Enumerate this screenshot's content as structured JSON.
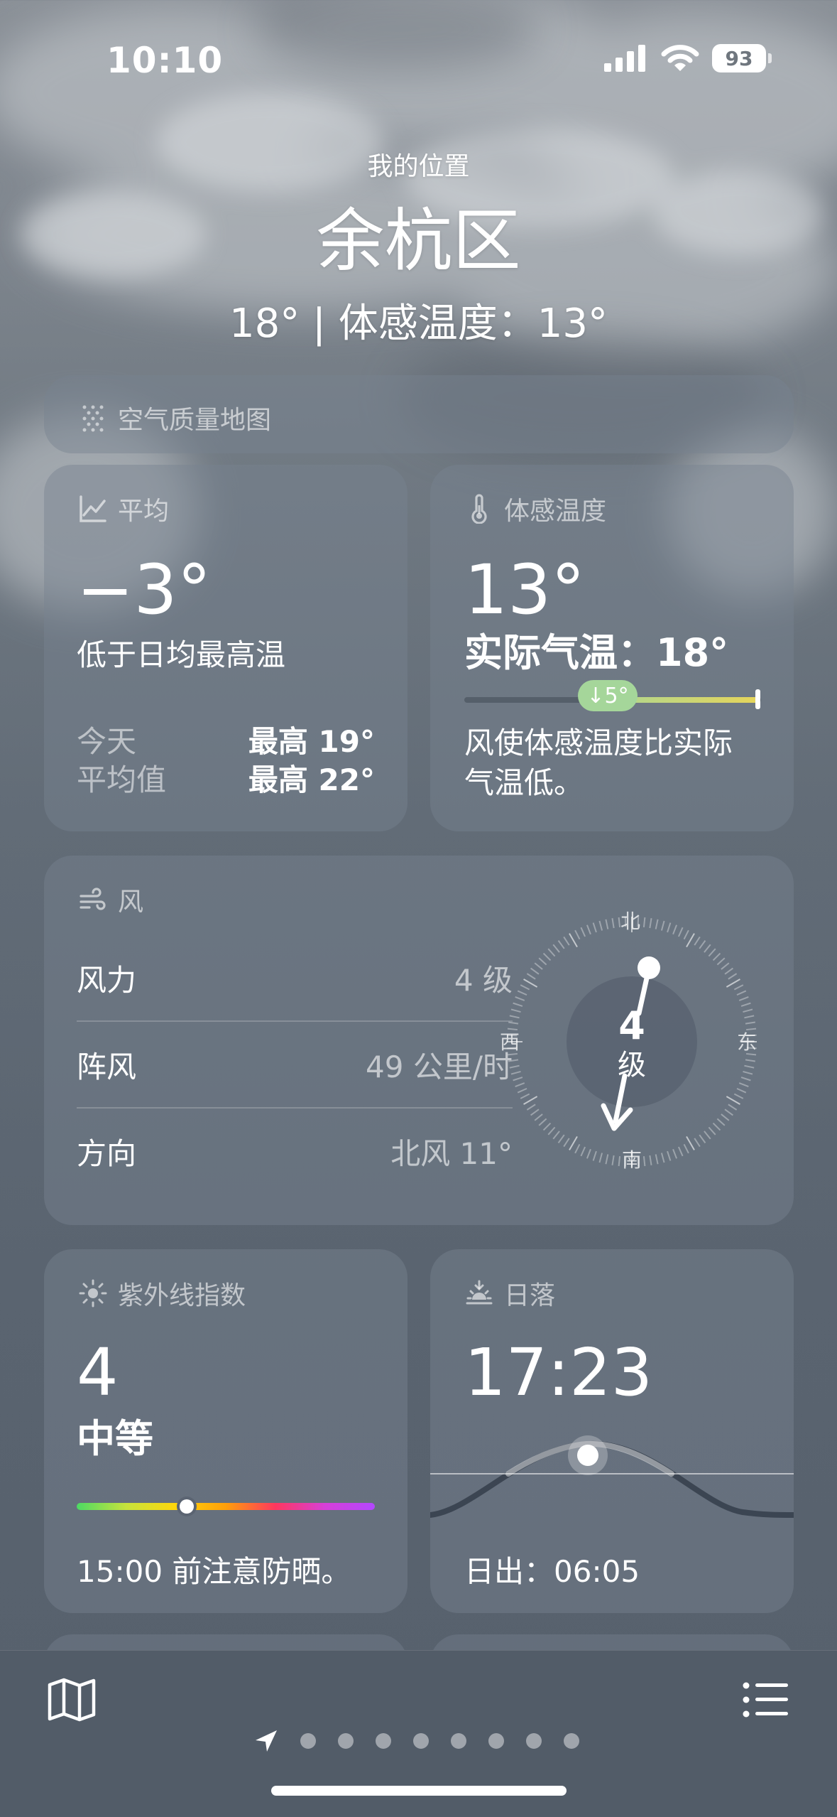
{
  "status_bar": {
    "time": "10:10",
    "battery": "93"
  },
  "header": {
    "location_label": "我的位置",
    "city": "余杭区",
    "temp_line": "18° | 体感温度：13°"
  },
  "air_quality": {
    "label": "空气质量地图"
  },
  "average": {
    "title": "平均",
    "value": "−3°",
    "description": "低于日均最高温",
    "rows": [
      {
        "label": "今天",
        "value": "最高 19°"
      },
      {
        "label": "平均值",
        "value": "最高 22°"
      }
    ]
  },
  "feels_like": {
    "title": "体感温度",
    "value": "13°",
    "actual": "实际气温：18°",
    "badge": "↓5°",
    "description_line1": "风使体感温度比实际",
    "description_line2": "气温低。",
    "colors": {
      "badge": "#a5d69a",
      "bar_end": "#e6d55a"
    }
  },
  "wind": {
    "title": "风",
    "rows": [
      {
        "label": "风力",
        "value": "4 级"
      },
      {
        "label": "阵风",
        "value": "49 公里/时"
      },
      {
        "label": "方向",
        "value": "北风 11°"
      }
    ],
    "compass": {
      "n": "北",
      "s": "南",
      "e": "东",
      "w": "西",
      "center_value": "4",
      "center_unit": "级"
    }
  },
  "uv": {
    "title": "紫外线指数",
    "value": "4",
    "level": "中等",
    "note": "15:00 前注意防晒。",
    "scale_position": 0.37
  },
  "sunset": {
    "title": "日落",
    "time": "17:23",
    "sunrise": "日出：06:05"
  },
  "bottom_bar": {
    "page_count": 8
  }
}
